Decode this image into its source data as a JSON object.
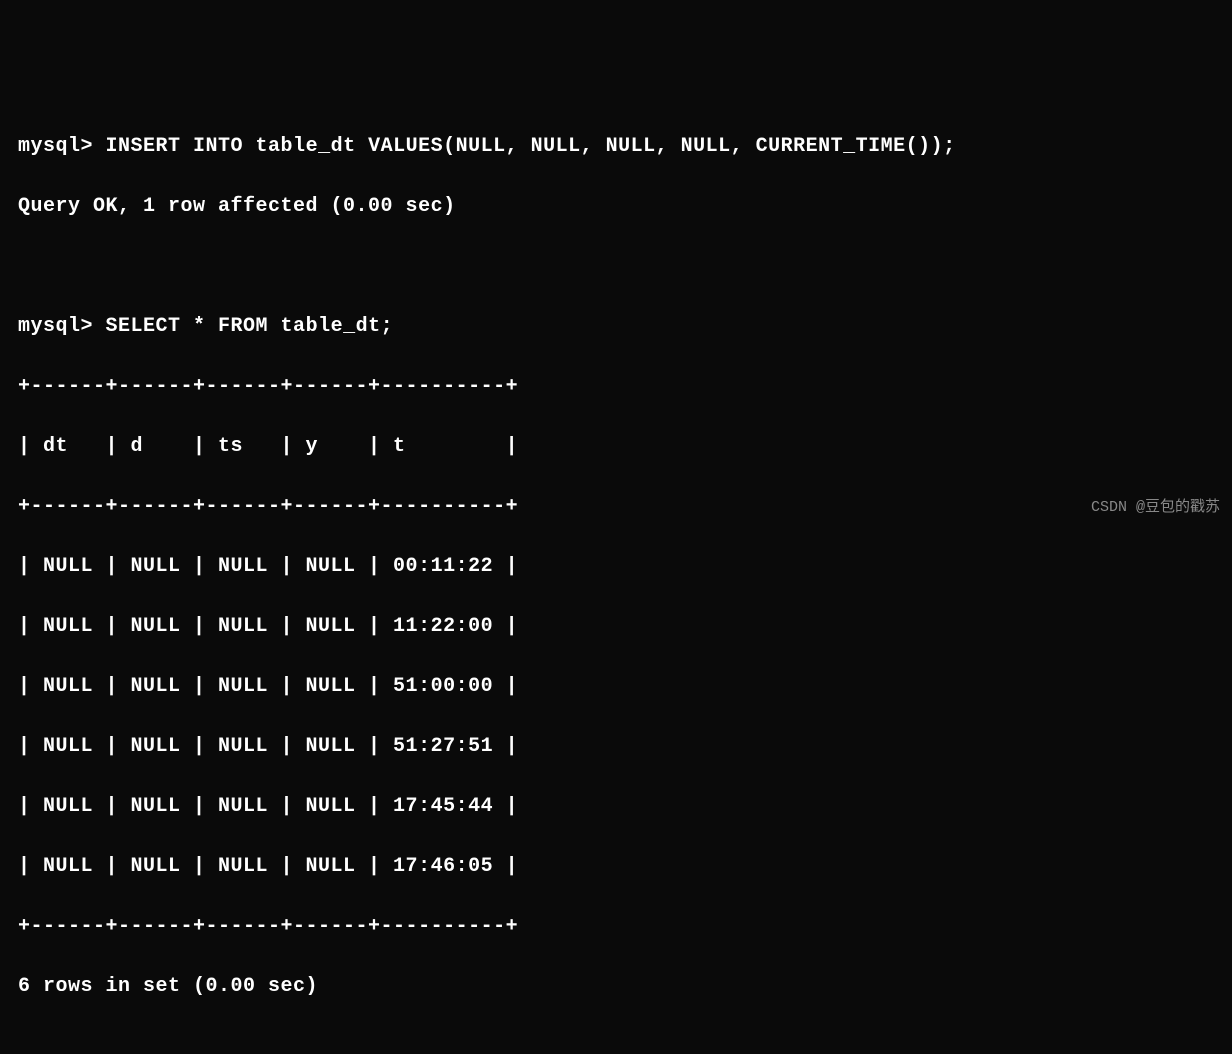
{
  "terminal": {
    "prompt": "mysql>",
    "insert_command": "INSERT INTO table_dt VALUES(NULL, NULL, NULL, NULL, CURRENT_TIME());",
    "insert_result": "Query OK, 1 row affected (0.00 sec)",
    "select_command": "SELECT * FROM table_dt;",
    "table": {
      "border": "+------+------+------+------+----------+",
      "header": "| dt   | d    | ts   | y    | t        |",
      "columns": [
        "dt",
        "d",
        "ts",
        "y",
        "t"
      ],
      "rows": [
        {
          "dt": "NULL",
          "d": "NULL",
          "ts": "NULL",
          "y": "NULL",
          "t": "00:11:22"
        },
        {
          "dt": "NULL",
          "d": "NULL",
          "ts": "NULL",
          "y": "NULL",
          "t": "11:22:00"
        },
        {
          "dt": "NULL",
          "d": "NULL",
          "ts": "NULL",
          "y": "NULL",
          "t": "51:00:00"
        },
        {
          "dt": "NULL",
          "d": "NULL",
          "ts": "NULL",
          "y": "NULL",
          "t": "51:27:51"
        },
        {
          "dt": "NULL",
          "d": "NULL",
          "ts": "NULL",
          "y": "NULL",
          "t": "17:45:44"
        },
        {
          "dt": "NULL",
          "d": "NULL",
          "ts": "NULL",
          "y": "NULL",
          "t": "17:46:05"
        }
      ],
      "row_lines": [
        "| NULL | NULL | NULL | NULL | 00:11:22 |",
        "| NULL | NULL | NULL | NULL | 11:22:00 |",
        "| NULL | NULL | NULL | NULL | 51:00:00 |",
        "| NULL | NULL | NULL | NULL | 51:27:51 |",
        "| NULL | NULL | NULL | NULL | 17:45:44 |",
        "| NULL | NULL | NULL | NULL | 17:46:05 |"
      ]
    },
    "select_result": "6 rows in set (0.00 sec)"
  },
  "watermark": "CSDN @豆包的戳苏"
}
